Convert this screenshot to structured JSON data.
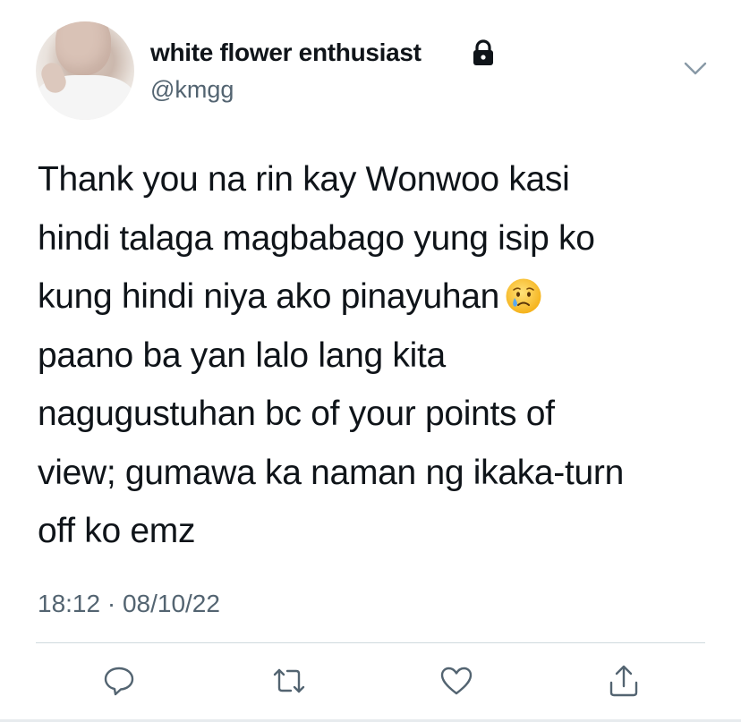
{
  "user": {
    "display_name": "white flower enthusiast",
    "handle": "@kmgg",
    "protected": true,
    "avatar_icon": "profile-photo"
  },
  "tweet": {
    "text": "Thank you na rin kay Wonwoo kasi\nhindi talaga magbabago yung isip ko\nkung hindi niya ako pinayuhan",
    "text_after_emoji": "paano ba yan lalo lang kita\nnagugustuhan bc of your points of\nview; gumawa ka naman ng ikaka-turn\noff ko emz",
    "emoji": "crying-face",
    "timestamp": "18:12 · 08/10/22"
  },
  "actions": [
    {
      "name": "reply",
      "icon": "reply-icon"
    },
    {
      "name": "retweet",
      "icon": "retweet-icon"
    },
    {
      "name": "like",
      "icon": "heart-icon"
    },
    {
      "name": "share",
      "icon": "share-icon"
    }
  ],
  "colors": {
    "text": "#0f1419",
    "secondary": "#536471",
    "divider": "#cfd9de"
  }
}
